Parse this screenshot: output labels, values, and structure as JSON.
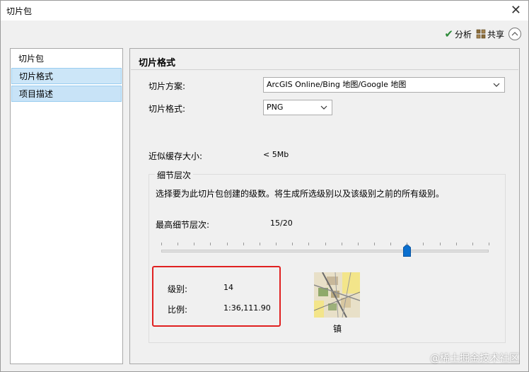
{
  "window": {
    "title": "切片包",
    "close_glyph": "✕"
  },
  "toolbar": {
    "analyze_label": "分析",
    "share_label": "共享",
    "collapse_glyph": "︿"
  },
  "sidebar": {
    "items": [
      {
        "label": "切片包"
      },
      {
        "label": "切片格式"
      },
      {
        "label": "项目描述"
      }
    ]
  },
  "main": {
    "heading": "切片格式",
    "scheme_label": "切片方案:",
    "scheme_value": "ArcGIS Online/Bing 地图/Google 地图",
    "format_label": "切片格式:",
    "format_value": "PNG",
    "cache_label": "近似缓存大小:",
    "cache_value": "< 5Mb",
    "lod": {
      "title": "细节层次",
      "description": "选择要为此切片包创建的级数。将生成所选级别以及该级别之前的所有级别。",
      "max_label": "最高细节层次:",
      "max_value": "15/20",
      "slider_level": 15,
      "slider_max": 20,
      "level_label": "级别:",
      "level_value": "14",
      "scale_label": "比例:",
      "scale_value": "1:36,111.90",
      "preview_caption": "镇"
    }
  },
  "watermark": "@稀土掘金技术社区",
  "colors": {
    "accent_red": "#e02020",
    "select_blue": "#cce6f8",
    "thumb_blue": "#0a6fcf"
  }
}
